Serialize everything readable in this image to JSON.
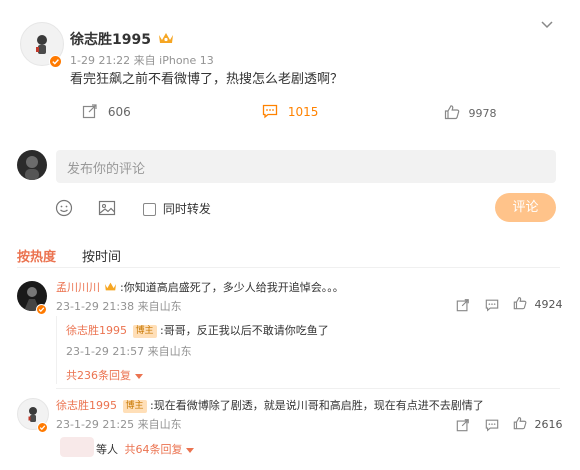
{
  "post": {
    "author": "徐志胜1995",
    "meta": "1-29 21:22  来自 iPhone 13",
    "content": "看完狂飙之前不看微博了，热搜怎么老剧透啊？",
    "repost_count": "606",
    "comment_count": "1015",
    "like_count": "9978",
    "vip_badge_color": "#f6a623",
    "verified_color": "#ff7a00"
  },
  "composer": {
    "placeholder": "发布你的评论",
    "repost_label": "同时转发",
    "submit_label": "评论"
  },
  "sort_tabs": {
    "hot": "按热度",
    "time": "按时间"
  },
  "comments": [
    {
      "user": "孟川川川",
      "text": ":你知道高启盛死了，多少人给我开追悼会。。。",
      "meta": "23-1-29 21:38 来自山东",
      "likes": "4924",
      "reply": {
        "user": "徐志胜1995",
        "tag": "博主",
        "text": ":哥哥，反正我以后不敢请你吃鱼了",
        "meta": "23-1-29 21:57 来自山东"
      },
      "more": "共236条回复"
    },
    {
      "user": "徐志胜1995",
      "tag": "博主",
      "text": ":现在看微博除了剧透，就是说川哥和高启胜，现在有点进不去剧情了",
      "meta": "23-1-29 21:25 来自山东",
      "likes": "2616",
      "more_prefix": "等人",
      "more": "共64条回复"
    }
  ]
}
